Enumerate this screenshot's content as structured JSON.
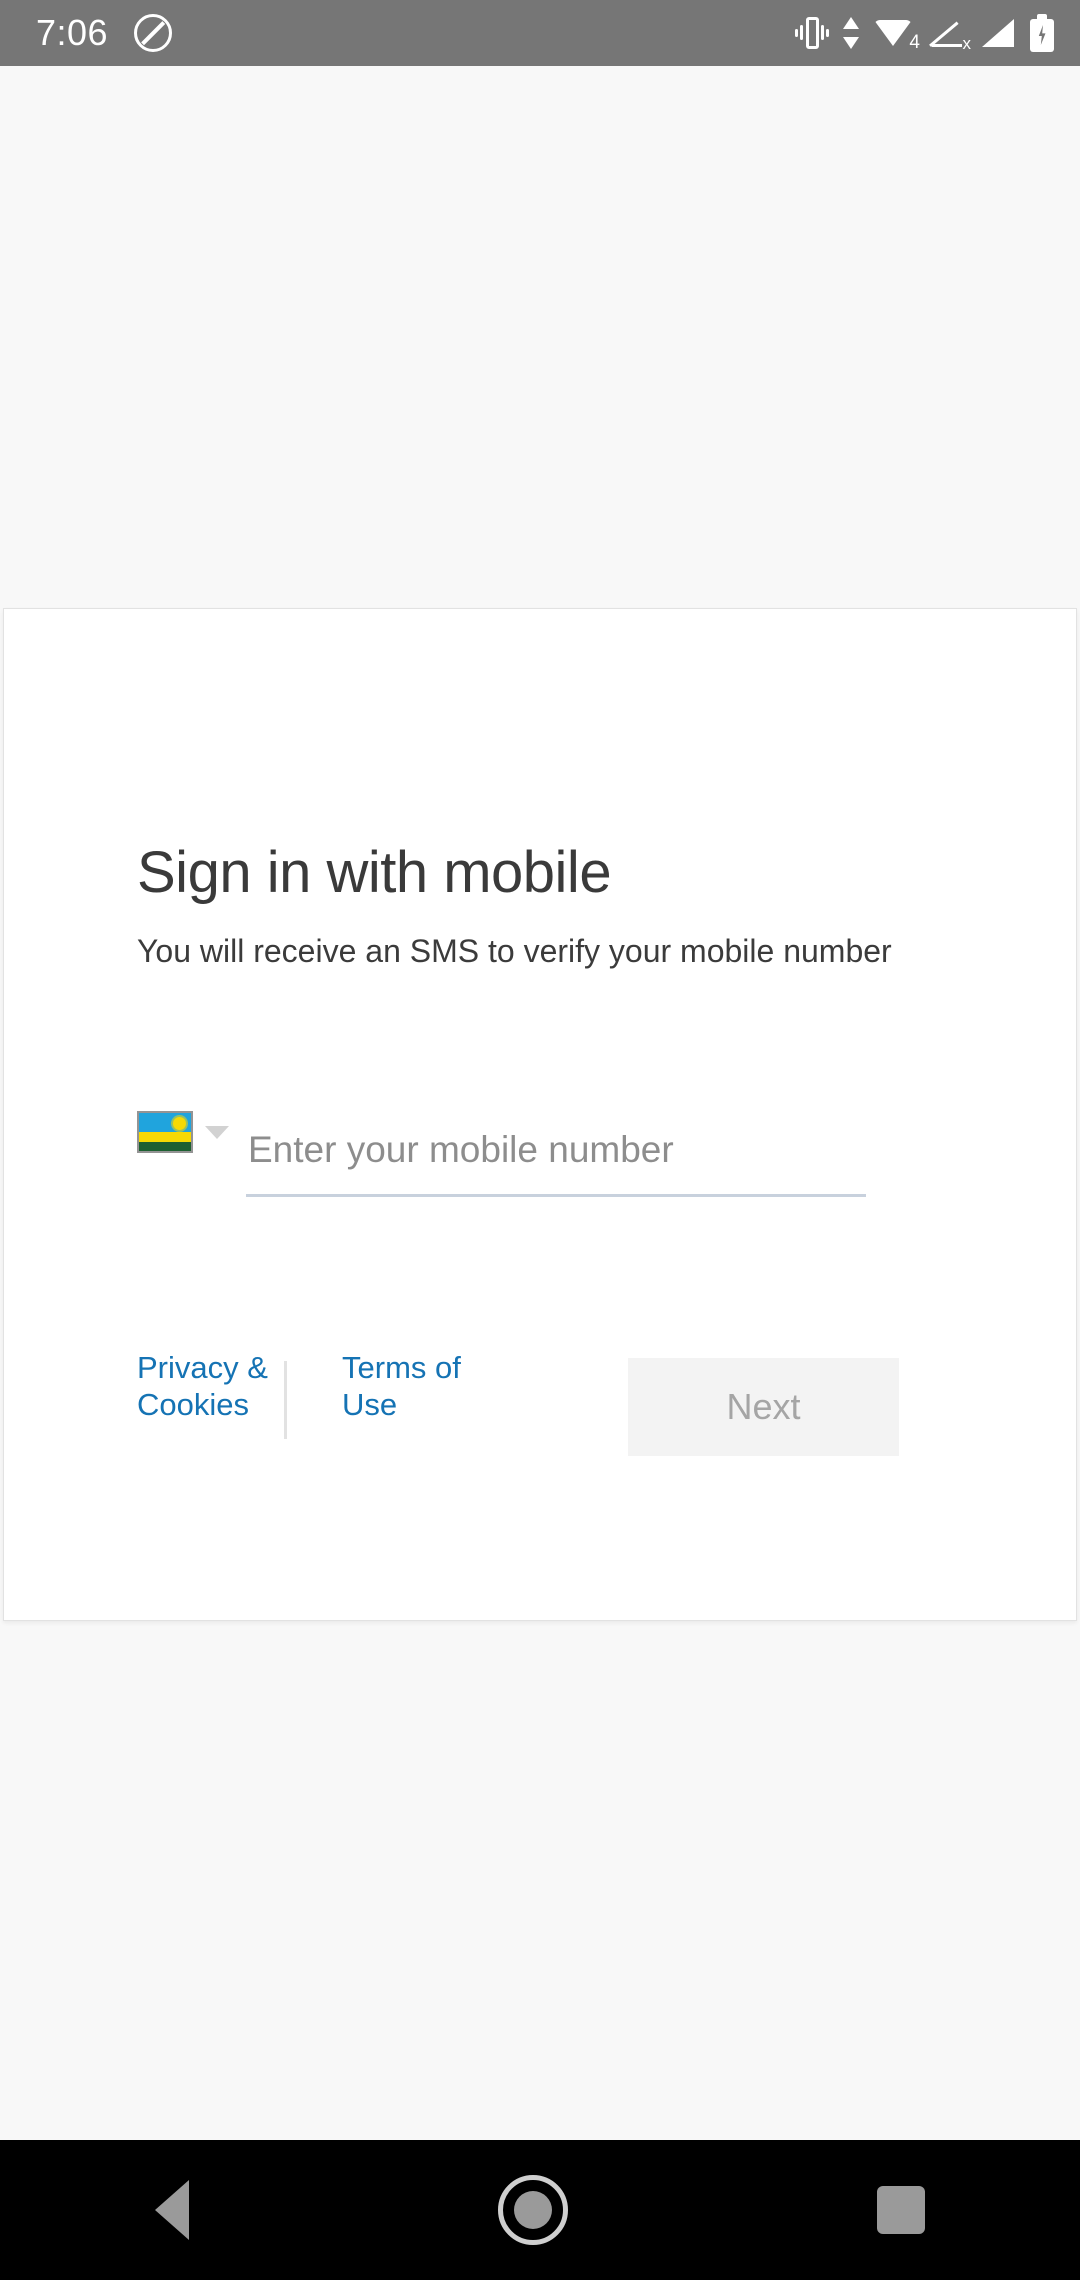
{
  "status_bar": {
    "time": "7:06",
    "icons": [
      {
        "name": "do-not-disturb-icon"
      },
      {
        "name": "vibrate-icon"
      },
      {
        "name": "data-transfer-arrows-icon"
      },
      {
        "name": "wifi-icon",
        "badge": "4"
      },
      {
        "name": "no-sim-signal-icon",
        "badge": "x"
      },
      {
        "name": "cellular-signal-icon"
      },
      {
        "name": "battery-charging-icon"
      }
    ]
  },
  "card": {
    "title": "Sign in with mobile",
    "subtitle": "You will receive an SMS to verify your mobile number",
    "country_picker": {
      "name": "country-code-picker",
      "flag": "rwanda-flag-icon",
      "chevron": "chevron-down-icon"
    },
    "phone_input": {
      "placeholder": "Enter your mobile number",
      "value": ""
    },
    "footer": {
      "privacy_label": "Privacy & Cookies",
      "terms_label": "Terms of Use",
      "next_label": "Next"
    }
  },
  "nav_bar": {
    "back": "back-nav-button",
    "home": "home-nav-button",
    "recents": "recents-nav-button"
  },
  "colors": {
    "status_bar_bg": "#767676",
    "page_bg": "#f8f8f8",
    "card_bg": "#ffffff",
    "link_blue": "#1573b4",
    "input_underline": "#c8d1dd",
    "next_bg": "#f3f3f3",
    "next_text": "#a5a5a5",
    "nav_bg": "#000000"
  }
}
